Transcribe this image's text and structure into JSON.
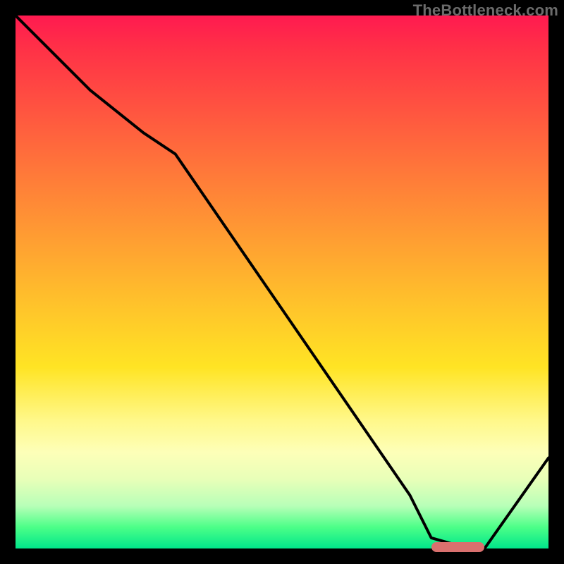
{
  "watermark": "TheBottleneck.com",
  "chart_data": {
    "type": "line",
    "title": "",
    "xlabel": "",
    "ylabel": "",
    "xlim": [
      0,
      100
    ],
    "ylim": [
      0,
      100
    ],
    "grid": false,
    "series": [
      {
        "name": "curve",
        "x": [
          0,
          14,
          24,
          30,
          74,
          78,
          85,
          88,
          100
        ],
        "values": [
          100,
          86,
          78,
          74,
          10,
          2,
          0,
          0,
          17
        ]
      }
    ],
    "marker": {
      "x_start": 78,
      "x_end": 88,
      "y": 0
    },
    "gradient_stops": [
      {
        "pct": 0,
        "color": "#ff1a50"
      },
      {
        "pct": 50,
        "color": "#ffc22b"
      },
      {
        "pct": 80,
        "color": "#fdffb8"
      },
      {
        "pct": 100,
        "color": "#00e68a"
      }
    ]
  }
}
